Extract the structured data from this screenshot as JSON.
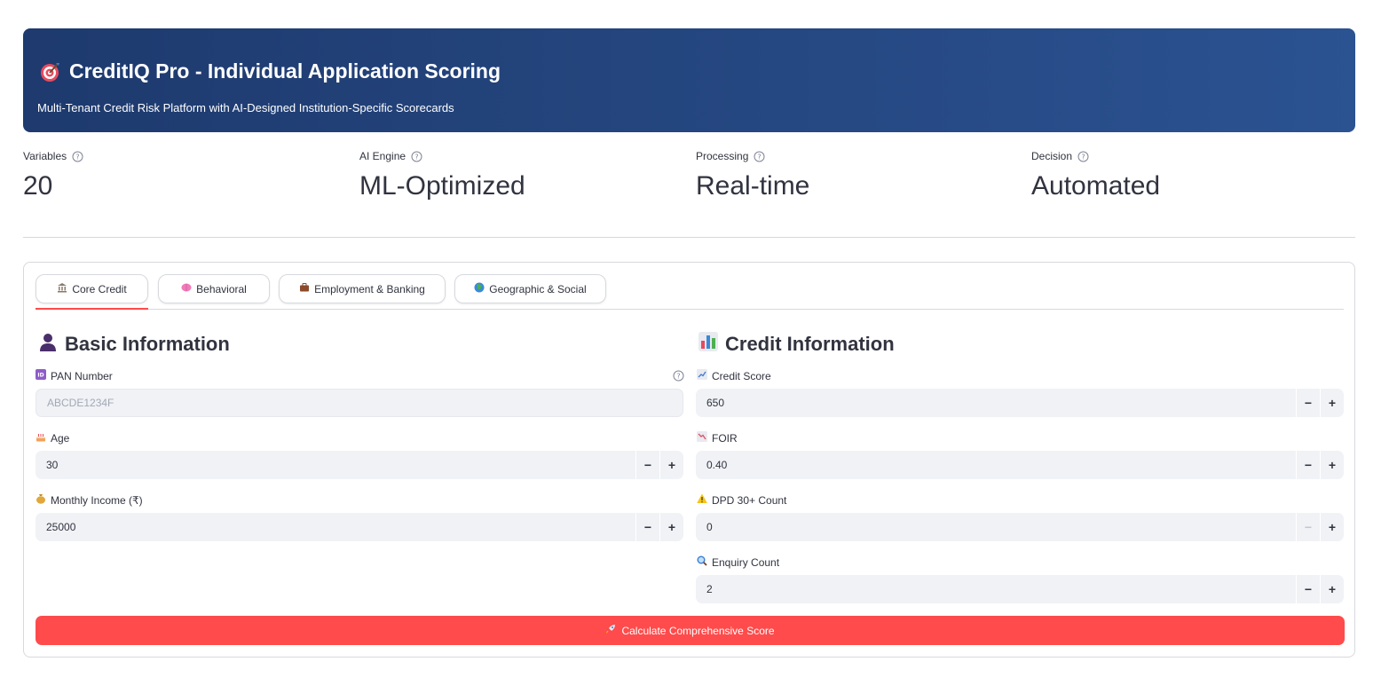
{
  "header": {
    "title": "CreditIQ Pro - Individual Application Scoring",
    "subtitle": "Multi-Tenant Credit Risk Platform with AI-Designed Institution-Specific Scorecards",
    "icon": "target-icon"
  },
  "metrics": [
    {
      "label": "Variables",
      "value": "20"
    },
    {
      "label": "AI Engine",
      "value": "ML-Optimized"
    },
    {
      "label": "Processing",
      "value": "Real-time"
    },
    {
      "label": "Decision",
      "value": "Automated"
    }
  ],
  "tabs": [
    {
      "label": "Core Credit",
      "icon": "bank-icon",
      "active": true
    },
    {
      "label": "Behavioral",
      "icon": "brain-icon",
      "active": false
    },
    {
      "label": "Employment & Banking",
      "icon": "briefcase-icon",
      "active": false
    },
    {
      "label": "Geographic & Social",
      "icon": "globe-icon",
      "active": false
    }
  ],
  "basic_info": {
    "title": "Basic Information",
    "pan": {
      "label": "PAN Number",
      "placeholder": "ABCDE1234F"
    },
    "age": {
      "label": "Age",
      "value": "30"
    },
    "income": {
      "label": "Monthly Income (₹)",
      "value": "25000"
    }
  },
  "credit_info": {
    "title": "Credit Information",
    "credit_score": {
      "label": "Credit Score",
      "value": "650"
    },
    "foir": {
      "label": "FOIR",
      "value": "0.40"
    },
    "dpd": {
      "label": "DPD 30+ Count",
      "value": "0"
    },
    "enquiry": {
      "label": "Enquiry Count",
      "value": "2"
    }
  },
  "stepper": {
    "minus": "−",
    "plus": "+"
  },
  "calculate_button": {
    "label": "Calculate Comprehensive Score"
  },
  "colors": {
    "header_start": "#1e3a6e",
    "header_end": "#2b5291",
    "accent": "#ff4b4b",
    "input_bg": "#f0f2f6"
  }
}
